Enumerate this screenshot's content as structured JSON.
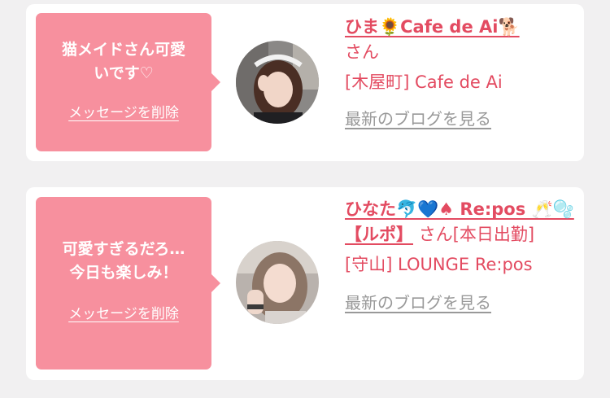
{
  "favorites": [
    {
      "bubble_message_line1": "猫メイドさん可愛",
      "bubble_message_line2": "いです♡",
      "delete_label": "メッセージを削除",
      "cast_name": "ひま🌻Cafe de Ai🐕",
      "cast_suffix": "さん",
      "shop": "[木屋町] Cafe de Ai",
      "blog_link": "最新のブログを見る"
    },
    {
      "bubble_message_line1": "可愛すぎるだろ…",
      "bubble_message_line2": "今日も楽しみ！",
      "delete_label": "メッセージを削除",
      "cast_name": "ひなた🐬💙♠ Re:pos 🥂🫧【ルポ】",
      "cast_suffix": "さん[本日出勤]",
      "shop": "[守山] LOUNGE Re:pos",
      "blog_link": "最新のブログを見る"
    }
  ]
}
